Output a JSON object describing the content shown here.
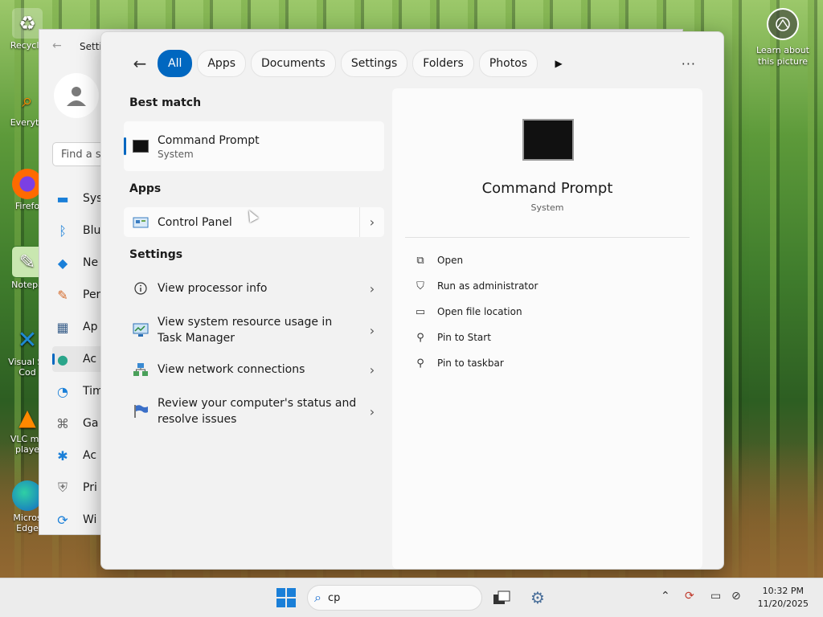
{
  "desktop": {
    "icons": [
      {
        "label": "Recycle",
        "icon": "recycle-bin-icon"
      },
      {
        "label": "Everyth",
        "icon": "everything-app-icon"
      },
      {
        "label": "Firefo",
        "icon": "firefox-icon"
      },
      {
        "label": "Notepa",
        "icon": "notepad-icon"
      },
      {
        "label": "Visual St",
        "label2": "Cod",
        "icon": "vscode-icon"
      },
      {
        "label": "VLC me",
        "label2": "playe",
        "icon": "vlc-icon"
      },
      {
        "label": "Micros",
        "label2": "Edge",
        "icon": "edge-icon"
      }
    ],
    "learn_about": "Learn about this picture"
  },
  "settings_window": {
    "title": "Setti",
    "search_placeholder": "Find a se",
    "nav": [
      {
        "label": "Sys",
        "icon": "system-icon"
      },
      {
        "label": "Blu",
        "icon": "bluetooth-icon"
      },
      {
        "label": "Ne",
        "icon": "network-icon"
      },
      {
        "label": "Per",
        "icon": "personalization-icon"
      },
      {
        "label": "Ap",
        "icon": "apps-icon"
      },
      {
        "label": "Ac",
        "icon": "accounts-icon",
        "selected": true
      },
      {
        "label": "Tim",
        "icon": "time-icon"
      },
      {
        "label": "Ga",
        "icon": "gaming-icon"
      },
      {
        "label": "Ac",
        "icon": "accessibility-icon"
      },
      {
        "label": "Pri",
        "icon": "privacy-icon"
      },
      {
        "label": "Wi",
        "icon": "windows-update-icon"
      }
    ]
  },
  "search": {
    "filters": [
      "All",
      "Apps",
      "Documents",
      "Settings",
      "Folders",
      "Photos"
    ],
    "active_filter": "All",
    "best_match_heading": "Best match",
    "best_match": {
      "name": "Command Prompt",
      "type": "System"
    },
    "apps_heading": "Apps",
    "apps": [
      {
        "name": "Control Panel"
      }
    ],
    "settings_heading": "Settings",
    "settings_results": [
      {
        "line1": "View processor info",
        "line2": "",
        "icon": "info-icon"
      },
      {
        "line1": "View system resource usage in",
        "line2": "Task Manager",
        "icon": "task-manager-icon"
      },
      {
        "line1": "View network connections",
        "line2": "",
        "icon": "network-connections-icon"
      },
      {
        "line1": "Review your computer's status and",
        "line2": "resolve issues",
        "icon": "security-flag-icon"
      }
    ],
    "preview": {
      "name": "Command Prompt",
      "type": "System",
      "actions": [
        {
          "label": "Open",
          "icon": "open-external-icon"
        },
        {
          "label": "Run as administrator",
          "icon": "shield-admin-icon"
        },
        {
          "label": "Open file location",
          "icon": "folder-icon"
        },
        {
          "label": "Pin to Start",
          "icon": "pin-icon"
        },
        {
          "label": "Pin to taskbar",
          "icon": "pin-icon"
        }
      ]
    }
  },
  "taskbar": {
    "search_value": "cp",
    "time": "10:32 PM",
    "date": "11/20/2025"
  },
  "colors": {
    "accent": "#0067c0"
  }
}
